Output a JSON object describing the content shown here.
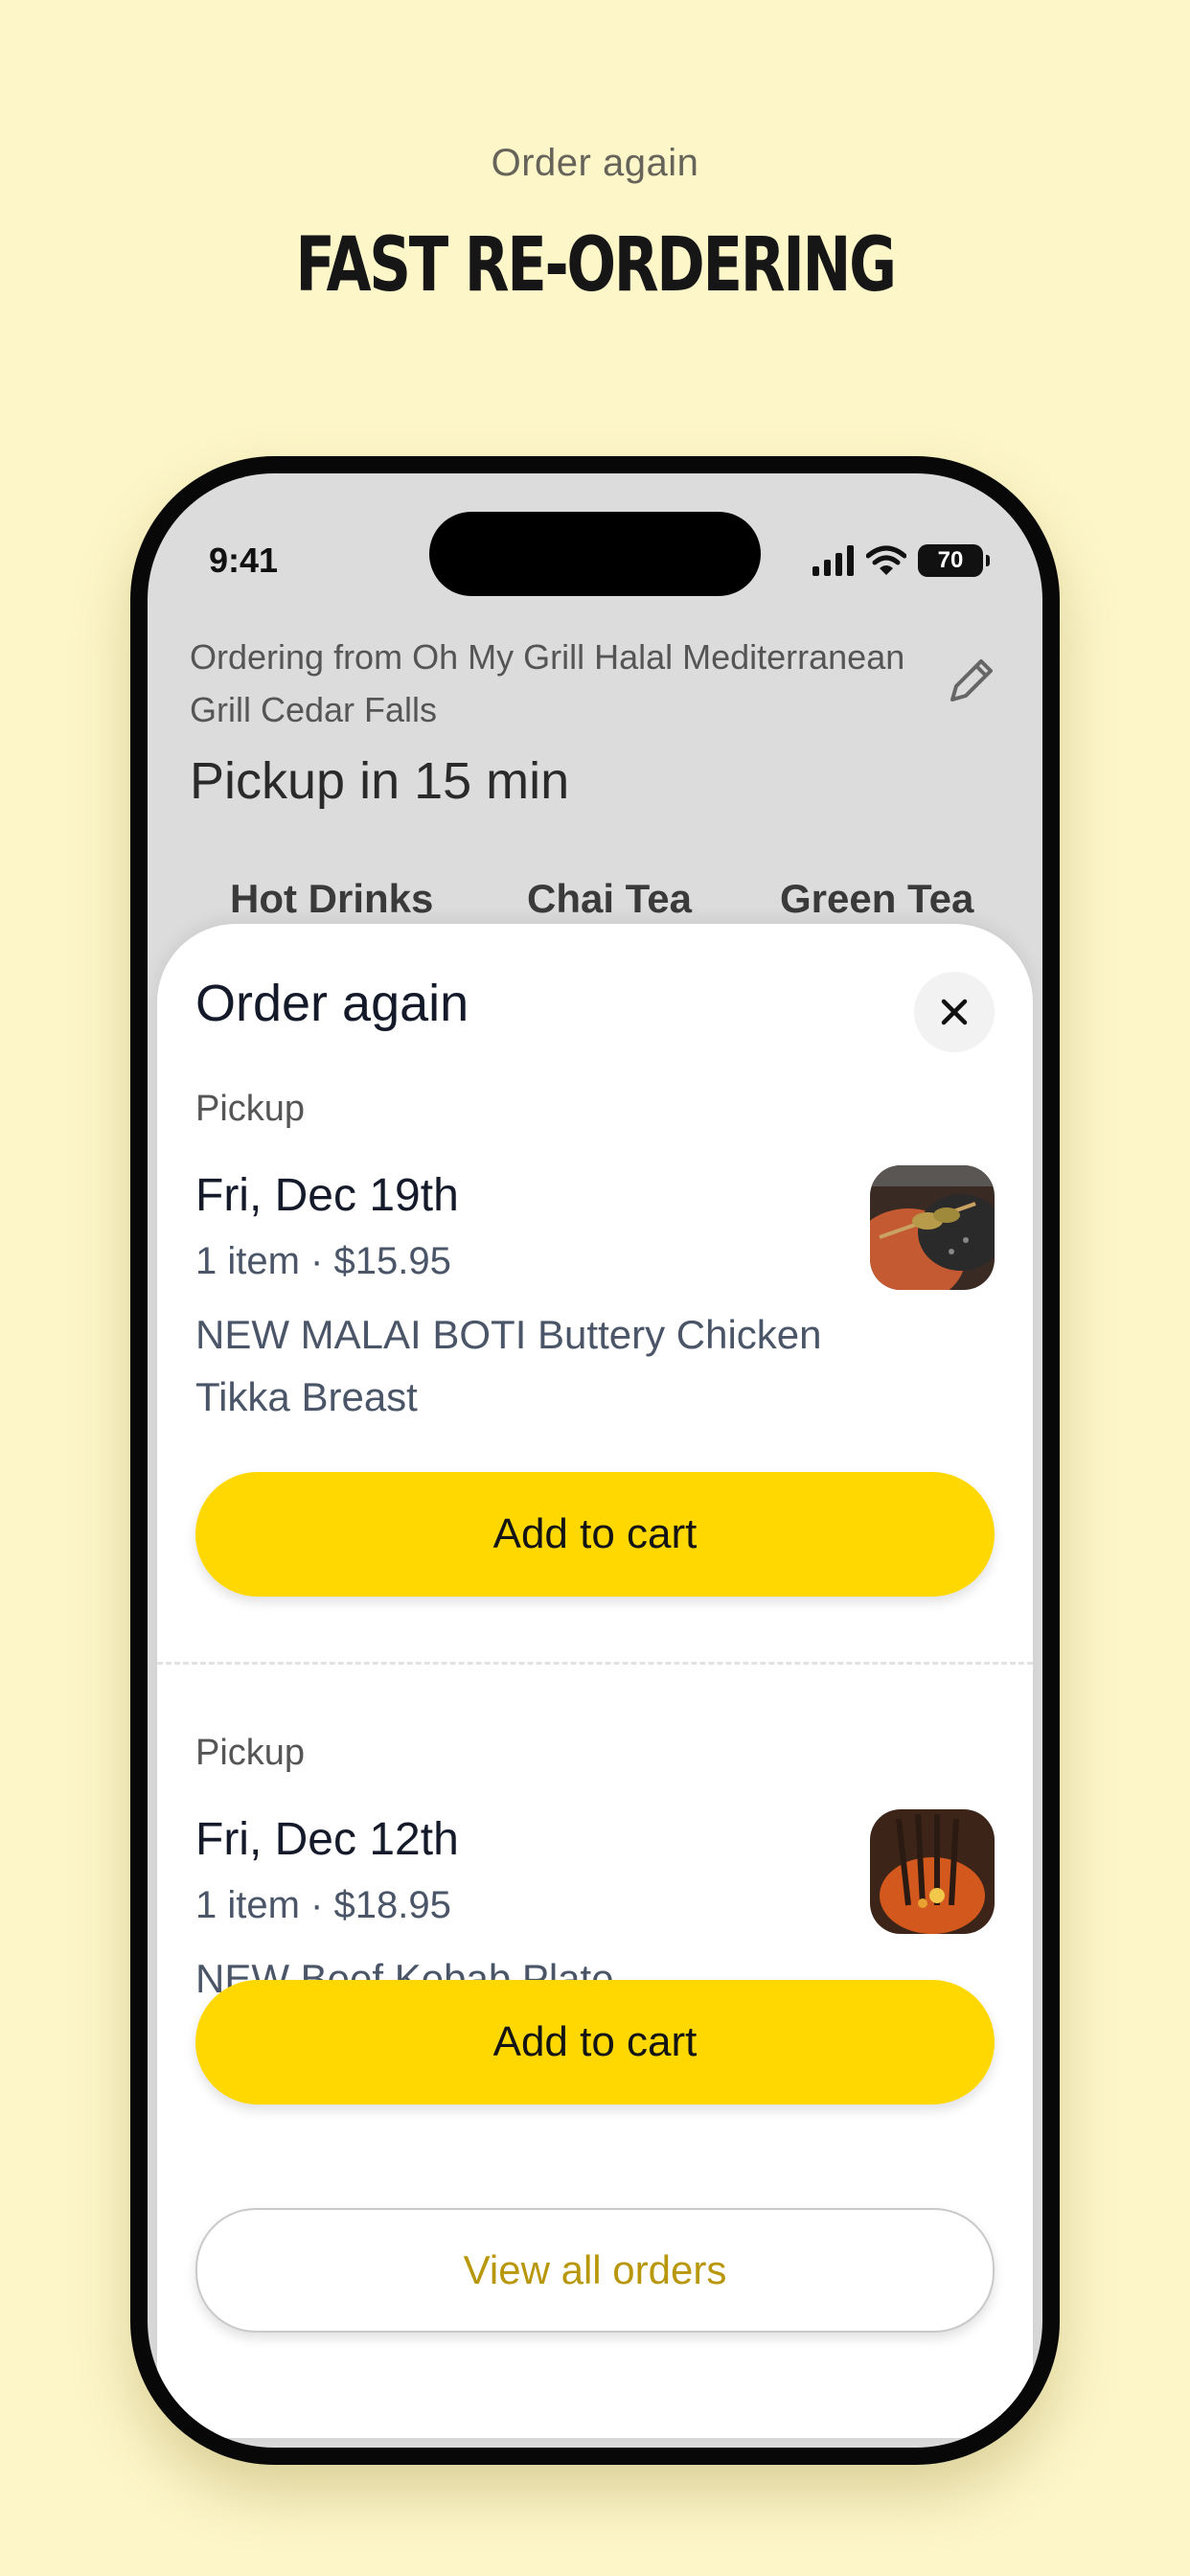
{
  "marketing": {
    "eyebrow": "Order again",
    "headline": "FAST RE-ORDERING"
  },
  "status_bar": {
    "time": "9:41",
    "battery": "70"
  },
  "header": {
    "ordering_from": "Ordering from Oh My Grill Halal Mediterranean Grill Cedar Falls",
    "pickup_time": "Pickup in 15 min"
  },
  "tabs": [
    "Hot Drinks",
    "Chai Tea",
    "Green Tea"
  ],
  "sheet": {
    "title": "Order again",
    "orders": [
      {
        "mode": "Pickup",
        "date": "Fri, Dec 19th",
        "meta": "1 item · $15.95",
        "items": "NEW MALAI BOTI Buttery Chicken Tikka Breast",
        "button": "Add to cart"
      },
      {
        "mode": "Pickup",
        "date": "Fri, Dec 12th",
        "meta": "1 item · $18.95",
        "items": "NEW Beef Kebab Plate",
        "button": "Add to cart"
      }
    ],
    "view_all": "View all orders"
  },
  "colors": {
    "background": "#fdf6c8",
    "accent": "#fed800",
    "link": "#b8970a"
  }
}
